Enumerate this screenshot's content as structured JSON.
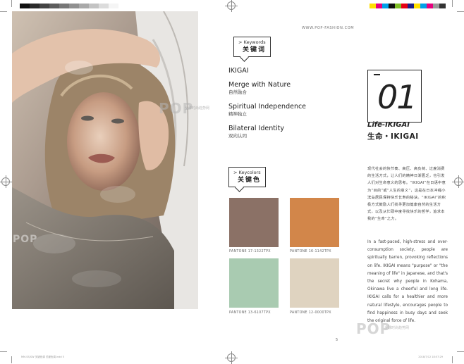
{
  "header": {
    "url": "WWW.POP-FASHION.COM"
  },
  "keywords_tag": {
    "en": "> Keywords",
    "cn": "关键词"
  },
  "keywords": [
    {
      "en": "IKIGAI",
      "cn": ""
    },
    {
      "en": "Merge with Nature",
      "cn": "自然融合"
    },
    {
      "en": "Spiritual Independence",
      "cn": "精神独立"
    },
    {
      "en": "Bilateral Identity",
      "cn": "双向认同"
    }
  ],
  "keycolors_tag": {
    "en": "> Keycolors",
    "cn": "关键色"
  },
  "swatches": [
    {
      "color": "#8b7166",
      "pantone": "PANTONE  17-1322TPX"
    },
    {
      "color": "#d2864a",
      "pantone": "PANTONE  16-1142TPX"
    },
    {
      "color": "#a9cbb1",
      "pantone": "PANTONE  13-6107TPX"
    },
    {
      "color": "#dfd3c0",
      "pantone": "PANTONE  12-0000TPX"
    }
  ],
  "theme": {
    "number": "01",
    "title_en": "Life-IKIGAI",
    "title_cn": "生命・IKIGAI"
  },
  "body_cn": "现代社会的快节奏、高压、高负荷、过度消费的生活方式，让人们的精神日渐匮乏，也引发人们对生命意义的思考。“IKIGAI”在日语中意为“目的”或“人生的意义”，这是在日本冲绳小滨岛居民保持快乐长寿的秘诀。“IKIGAI”的积极方式鼓励人们找寻更加健康自然的生活方式，以及从忙碌中度寻找快乐的哲学，追求本我的“生命”之力。",
  "body_en": "In a fast-paced, high-stress and over-consumption society, people are spiritually barren, provoking reflections on life. IKIGAI means \"purpose\" or \"the meaning of life\" in Japanese, and that's the secret why people in Kohama, Okinawa live a cheerful and long life. IKIGAI calls for a healthier and more natural lifestyle, encourages people to find happiness in busy days and seek the original force of life.",
  "watermark": {
    "text": "POP",
    "sub": "全球时尚趋势网"
  },
  "page_number": "5",
  "footer": {
    "left": "MM-SS/SW 关键色调 关键色调.indd 5",
    "right": "2018/7/12  18:57:29"
  },
  "colors": {
    "gray_bar": [
      "#111111",
      "#2b2b2b",
      "#444444",
      "#5d5d5d",
      "#777777",
      "#909090",
      "#a9a9a9",
      "#c3c3c3",
      "#dcdcdc",
      "#f5f5f5"
    ],
    "color_bar": [
      "#ffde00",
      "#e6007e",
      "#00a0e9",
      "#111111",
      "#7fbe26",
      "#e60012",
      "#1d2088",
      "#ffe000",
      "#00a0e9",
      "#e6007e",
      "#999999",
      "#333333"
    ]
  }
}
